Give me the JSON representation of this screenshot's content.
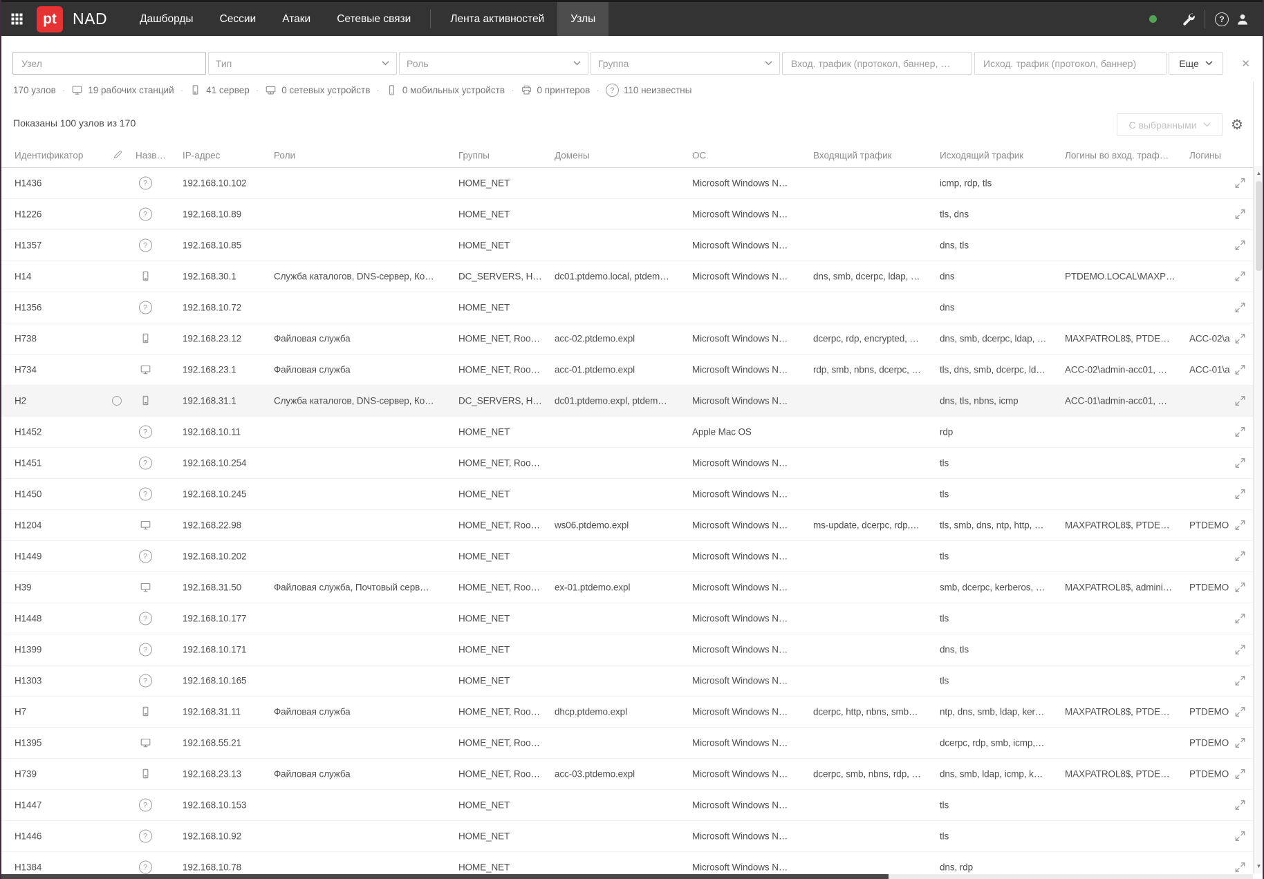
{
  "navbar": {
    "logo_text": "pt",
    "product": "NAD",
    "tabs": [
      {
        "label": "Дашборды",
        "active": false
      },
      {
        "label": "Сессии",
        "active": false
      },
      {
        "label": "Атаки",
        "active": false
      },
      {
        "label": "Сетевые связи",
        "active": false,
        "divider_after": true
      },
      {
        "label": "Лента активностей",
        "active": false
      },
      {
        "label": "Узлы",
        "active": true
      }
    ],
    "right_icons": [
      "status-dot",
      "wrench-icon",
      "help-icon",
      "user-icon"
    ]
  },
  "filters": {
    "node_placeholder": "Узел",
    "type_placeholder": "Тип",
    "role_placeholder": "Роль",
    "group_placeholder": "Группа",
    "in_traffic_placeholder": "Вход. трафик (протокол, баннер, …",
    "out_traffic_placeholder": "Исход. трафик (протокол, баннер)",
    "more_label": "Еще",
    "close_glyph": "✕"
  },
  "stats": {
    "items": [
      {
        "icon": "",
        "text": "170 узлов"
      },
      {
        "icon": "workstation",
        "text": "19 рабочих станций"
      },
      {
        "icon": "server",
        "text": "41 сервер"
      },
      {
        "icon": "network-device",
        "text": "0 сетевых устройств"
      },
      {
        "icon": "mobile",
        "text": "0 мобильных устройств"
      },
      {
        "icon": "printer",
        "text": "0 принтеров"
      },
      {
        "icon": "unknown",
        "text": "110 неизвестны"
      }
    ]
  },
  "toolbar": {
    "shown_text": "Показаны 100 узлов из 170",
    "with_selected_label": "С выбранными"
  },
  "table": {
    "columns": [
      "Идентификатор",
      "Назв…",
      "IP-адрес",
      "Роли",
      "Группы",
      "Домены",
      "ОС",
      "Входящий трафик",
      "Исходящий трафик",
      "Логины во вход. траф…",
      "Логины"
    ],
    "rows": [
      {
        "id": "H1436",
        "type": "unknown",
        "named": false,
        "highlighted": false,
        "ip": "192.168.10.102",
        "roles": "",
        "groups": "HOME_NET",
        "domains": "",
        "os": "Microsoft Windows N…",
        "traffic_in": "",
        "traffic_out": "icmp, rdp, tls",
        "logins_in": "",
        "logins": ""
      },
      {
        "id": "H1226",
        "type": "unknown",
        "named": false,
        "highlighted": false,
        "ip": "192.168.10.89",
        "roles": "",
        "groups": "HOME_NET",
        "domains": "",
        "os": "Microsoft Windows N…",
        "traffic_in": "",
        "traffic_out": "tls, dns",
        "logins_in": "",
        "logins": ""
      },
      {
        "id": "H1357",
        "type": "unknown",
        "named": false,
        "highlighted": false,
        "ip": "192.168.10.85",
        "roles": "",
        "groups": "HOME_NET",
        "domains": "",
        "os": "Microsoft Windows N…",
        "traffic_in": "",
        "traffic_out": "dns, tls",
        "logins_in": "",
        "logins": ""
      },
      {
        "id": "H14",
        "type": "server",
        "named": false,
        "highlighted": false,
        "ip": "192.168.30.1",
        "roles": "Служба каталогов, DNS-сервер, Ко…",
        "groups": "DC_SERVERS, H…",
        "domains": "dc01.ptdemo.local, ptdem…",
        "os": "Microsoft Windows N…",
        "traffic_in": "dns, smb, dcerpc, ldap, …",
        "traffic_out": "dns",
        "logins_in": "PTDEMO.LOCAL\\MAXP…",
        "logins": ""
      },
      {
        "id": "H1356",
        "type": "unknown",
        "named": false,
        "highlighted": false,
        "ip": "192.168.10.72",
        "roles": "",
        "groups": "HOME_NET",
        "domains": "",
        "os": "",
        "traffic_in": "",
        "traffic_out": "dns",
        "logins_in": "",
        "logins": ""
      },
      {
        "id": "H738",
        "type": "server",
        "named": false,
        "highlighted": false,
        "ip": "192.168.23.12",
        "roles": "Файловая служба",
        "groups": "HOME_NET, Roo…",
        "domains": "acc-02.ptdemo.expl",
        "os": "Microsoft Windows N…",
        "traffic_in": "dcerpc, rdp, encrypted, …",
        "traffic_out": "dns, smb, dcerpc, ldap, …",
        "logins_in": "MAXPATROL8$, PTDE…",
        "logins": "ACC-02\\a"
      },
      {
        "id": "H734",
        "type": "workstation",
        "named": false,
        "highlighted": false,
        "ip": "192.168.23.1",
        "roles": "Файловая служба",
        "groups": "HOME_NET, Roo…",
        "domains": "acc-01.ptdemo.expl",
        "os": "Microsoft Windows N…",
        "traffic_in": "rdp, smb, nbns, dcerpc, …",
        "traffic_out": "tls, dns, smb, dcerpc, ld…",
        "logins_in": "ACC-02\\admin-acc01, …",
        "logins": "ACC-01\\a"
      },
      {
        "id": "H2",
        "type": "server",
        "named": true,
        "highlighted": true,
        "ip": "192.168.31.1",
        "roles": "Служба каталогов, DNS-сервер, Ко…",
        "groups": "DC_SERVERS, H…",
        "domains": "dc01.ptdemo.expl, ptdem…",
        "os": "Microsoft Windows N…",
        "traffic_in": "",
        "traffic_out": "dns, tls, nbns, icmp",
        "logins_in": "ACC-01\\admin-acc01, …",
        "logins": ""
      },
      {
        "id": "H1452",
        "type": "unknown",
        "named": false,
        "highlighted": false,
        "ip": "192.168.10.11",
        "roles": "",
        "groups": "HOME_NET",
        "domains": "",
        "os": "Apple Mac OS",
        "traffic_in": "",
        "traffic_out": "rdp",
        "logins_in": "",
        "logins": ""
      },
      {
        "id": "H1451",
        "type": "unknown",
        "named": false,
        "highlighted": false,
        "ip": "192.168.10.254",
        "roles": "",
        "groups": "HOME_NET, Roo…",
        "domains": "",
        "os": "Microsoft Windows N…",
        "traffic_in": "",
        "traffic_out": "tls",
        "logins_in": "",
        "logins": ""
      },
      {
        "id": "H1450",
        "type": "unknown",
        "named": false,
        "highlighted": false,
        "ip": "192.168.10.245",
        "roles": "",
        "groups": "HOME_NET",
        "domains": "",
        "os": "Microsoft Windows N…",
        "traffic_in": "",
        "traffic_out": "tls",
        "logins_in": "",
        "logins": ""
      },
      {
        "id": "H1204",
        "type": "workstation",
        "named": false,
        "highlighted": false,
        "ip": "192.168.22.98",
        "roles": "",
        "groups": "HOME_NET, Roo…",
        "domains": "ws06.ptdemo.expl",
        "os": "Microsoft Windows N…",
        "traffic_in": "ms-update, dcerpc, rdp,…",
        "traffic_out": "tls, smb, dns, ntp, http, …",
        "logins_in": "MAXPATROL8$, PTDE…",
        "logins": "PTDEMO"
      },
      {
        "id": "H1449",
        "type": "unknown",
        "named": false,
        "highlighted": false,
        "ip": "192.168.10.202",
        "roles": "",
        "groups": "HOME_NET",
        "domains": "",
        "os": "Microsoft Windows N…",
        "traffic_in": "",
        "traffic_out": "tls",
        "logins_in": "",
        "logins": ""
      },
      {
        "id": "H39",
        "type": "workstation",
        "named": false,
        "highlighted": false,
        "ip": "192.168.31.50",
        "roles": "Файловая служба, Почтовый серв…",
        "groups": "HOME_NET, Roo…",
        "domains": "ex-01.ptdemo.expl",
        "os": "Microsoft Windows N…",
        "traffic_in": "",
        "traffic_out": "smb, dcerpc, kerberos, …",
        "logins_in": "MAXPATROL8$, admini…",
        "logins": "PTDEMO"
      },
      {
        "id": "H1448",
        "type": "unknown",
        "named": false,
        "highlighted": false,
        "ip": "192.168.10.177",
        "roles": "",
        "groups": "HOME_NET",
        "domains": "",
        "os": "Microsoft Windows N…",
        "traffic_in": "",
        "traffic_out": "tls",
        "logins_in": "",
        "logins": ""
      },
      {
        "id": "H1399",
        "type": "unknown",
        "named": false,
        "highlighted": false,
        "ip": "192.168.10.171",
        "roles": "",
        "groups": "HOME_NET",
        "domains": "",
        "os": "Microsoft Windows N…",
        "traffic_in": "",
        "traffic_out": "dns, tls",
        "logins_in": "",
        "logins": ""
      },
      {
        "id": "H1303",
        "type": "unknown",
        "named": false,
        "highlighted": false,
        "ip": "192.168.10.165",
        "roles": "",
        "groups": "HOME_NET",
        "domains": "",
        "os": "Microsoft Windows N…",
        "traffic_in": "",
        "traffic_out": "tls",
        "logins_in": "",
        "logins": ""
      },
      {
        "id": "H7",
        "type": "server",
        "named": false,
        "highlighted": false,
        "ip": "192.168.31.11",
        "roles": "Файловая служба",
        "groups": "HOME_NET, Roo…",
        "domains": "dhcp.ptdemo.expl",
        "os": "Microsoft Windows N…",
        "traffic_in": "dcerpc, http, nbns, smb…",
        "traffic_out": "ntp, dns, smb, ldap, ker…",
        "logins_in": "MAXPATROL8$, PTDE…",
        "logins": "PTDEMO"
      },
      {
        "id": "H1395",
        "type": "workstation",
        "named": false,
        "highlighted": false,
        "ip": "192.168.55.21",
        "roles": "",
        "groups": "HOME_NET, Roo…",
        "domains": "",
        "os": "Microsoft Windows N…",
        "traffic_in": "",
        "traffic_out": "dcerpc, rdp, smb, icmp,…",
        "logins_in": "",
        "logins": "PTDEMO"
      },
      {
        "id": "H739",
        "type": "server",
        "named": false,
        "highlighted": false,
        "ip": "192.168.23.13",
        "roles": "Файловая служба",
        "groups": "HOME_NET, Roo…",
        "domains": "acc-03.ptdemo.expl",
        "os": "Microsoft Windows N…",
        "traffic_in": "dcerpc, smb, nbns, rdp, …",
        "traffic_out": "dns, smb, ldap, icmp, k…",
        "logins_in": "MAXPATROL8$, PTDE…",
        "logins": "PTDEMO"
      },
      {
        "id": "H1447",
        "type": "unknown",
        "named": false,
        "highlighted": false,
        "ip": "192.168.10.153",
        "roles": "",
        "groups": "HOME_NET",
        "domains": "",
        "os": "Microsoft Windows N…",
        "traffic_in": "",
        "traffic_out": "tls",
        "logins_in": "",
        "logins": ""
      },
      {
        "id": "H1446",
        "type": "unknown",
        "named": false,
        "highlighted": false,
        "ip": "192.168.10.92",
        "roles": "",
        "groups": "HOME_NET",
        "domains": "",
        "os": "Microsoft Windows N…",
        "traffic_in": "",
        "traffic_out": "tls",
        "logins_in": "",
        "logins": ""
      },
      {
        "id": "H1384",
        "type": "unknown",
        "named": false,
        "highlighted": false,
        "ip": "192.168.10.78",
        "roles": "",
        "groups": "HOME_NET",
        "domains": "",
        "os": "Microsoft Windows N…",
        "traffic_in": "",
        "traffic_out": "dns, rdp",
        "logins_in": "",
        "logins": ""
      }
    ]
  },
  "colors": {
    "brand_red": "#e53232",
    "status_green": "#54a254",
    "navbar_bg": "#333333"
  }
}
